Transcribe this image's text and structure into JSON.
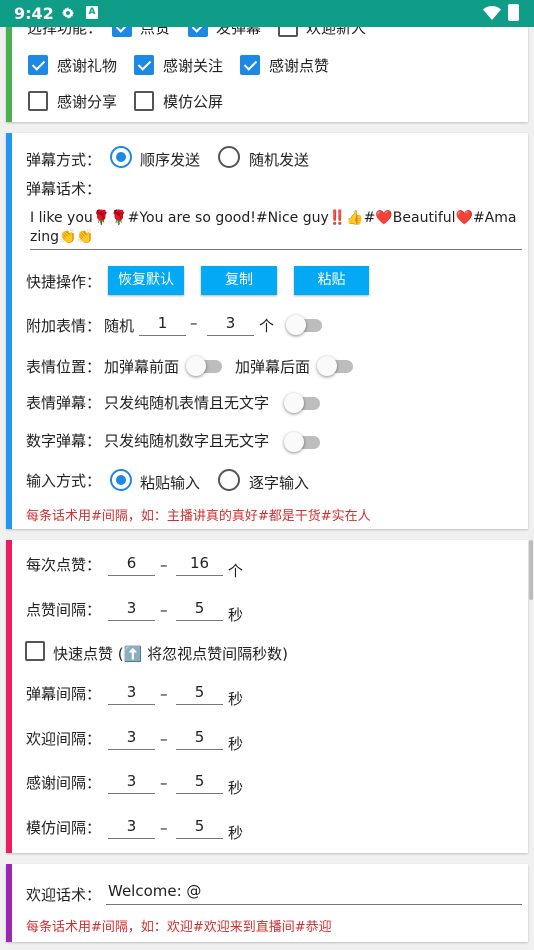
{
  "status": {
    "time": "9:42",
    "icons": [
      "settings-gear-icon",
      "a-notification-icon",
      "wifi-icon",
      "battery-charging-icon"
    ]
  },
  "card1": {
    "partial_label": "选择功能：",
    "partial_checks": [
      {
        "label": "点赞",
        "checked": true
      },
      {
        "label": "发弹幕",
        "checked": true
      },
      {
        "label": "欢迎新人",
        "checked": false
      }
    ],
    "checks": [
      {
        "label": "感谢礼物",
        "checked": true
      },
      {
        "label": "感谢关注",
        "checked": true
      },
      {
        "label": "感谢点赞",
        "checked": true
      },
      {
        "label": "感谢分享",
        "checked": false
      },
      {
        "label": "模仿公屏",
        "checked": false
      }
    ],
    "accent": "#4caf50"
  },
  "card2": {
    "accent": "#2196f3",
    "mode_label": "弹幕方式：",
    "mode_options": [
      "顺序发送",
      "随机发送"
    ],
    "mode_selected": 0,
    "script_label": "弹幕话术：",
    "script_text": "I like you🌹🌹#You are so good!#Nice guy‼️👍#❤️Beautiful❤️#Amazing👏👏",
    "quick_label": "快捷操作：",
    "buttons": [
      "恢复默认",
      "复制",
      "粘贴"
    ],
    "emoji_label": "附加表情：",
    "emoji_random": "随机",
    "emoji_min": "1",
    "emoji_max": "3",
    "emoji_unit": "个",
    "emoji_pos_label": "表情位置：",
    "emoji_pos_front": "加弹幕前面",
    "emoji_pos_back": "加弹幕后面",
    "emoji_danmu_label": "表情弹幕：",
    "emoji_danmu_text": "只发纯随机表情且无文字",
    "digit_label": "数字弹幕：",
    "digit_text": "只发纯随机数字且无文字",
    "input_label": "输入方式：",
    "input_options": [
      "粘贴输入",
      "逐字输入"
    ],
    "input_selected": 0,
    "hint": "每条话术用#间隔，如：主播讲真的真好#都是干货#实在人"
  },
  "card3": {
    "accent": "#e91e63",
    "like_label": "每次点赞：",
    "like_min": "6",
    "like_max": "16",
    "like_unit": "个",
    "like_int_label": "点赞间隔：",
    "like_int_min": "3",
    "like_int_max": "5",
    "unit_sec": "秒",
    "fast_like": "快速点赞 (⬆️ 将忽视点赞间隔秒数)",
    "fast_like_checked": false,
    "danmu_int_label": "弹幕间隔：",
    "danmu_int_min": "3",
    "danmu_int_max": "5",
    "welcome_int_label": "欢迎间隔：",
    "welcome_int_min": "3",
    "welcome_int_max": "5",
    "thanks_int_label": "感谢间隔：",
    "thanks_int_min": "3",
    "thanks_int_max": "5",
    "imitate_int_label": "模仿间隔：",
    "imitate_int_min": "3",
    "imitate_int_max": "5"
  },
  "card4": {
    "accent": "#9c27b0",
    "welcome_label": "欢迎话术：",
    "welcome_value": "Welcome: @",
    "hint": "每条话术用#间隔，如：欢迎#欢迎来到直播间#恭迎"
  },
  "dash": "—",
  "dash_short": "–"
}
